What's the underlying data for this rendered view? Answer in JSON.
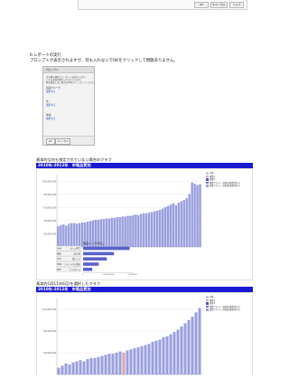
{
  "top_dialog": {
    "buttons": [
      "OK",
      "キャンセル",
      "ヘルプ"
    ]
  },
  "step": {
    "lines": [
      "6.レポートの実行",
      "プロンプトが表示されますが、何も入れないでOKをクリックして問題ありません。"
    ]
  },
  "prompt_dialog": {
    "title": "プロンプト",
    "help_lines": [
      "次の値を選択してレポートを表示します。",
      "これらは既定値が入力されています。",
      "値を変更しない場合はOKをクリックしてください。"
    ],
    "fields": [
      {
        "label": "商品グループ:",
        "value": "選択する"
      },
      {
        "label": "年:",
        "value": "選択する"
      },
      {
        "label": "地域:",
        "value": "選択する"
      }
    ],
    "buttons": {
      "ok": "OK",
      "cancel": "キャンセル"
    }
  },
  "section1": {
    "title": "基本的な何も指定されていない場合のグラフ",
    "banner": "2010年-2012年　市場品質別",
    "legend": [
      {
        "name": "全体",
        "color": "#c9c9ea"
      },
      {
        "name": "施策1",
        "color": "#e8a2a2"
      },
      {
        "name": "施策3",
        "color": "#4b54c2"
      },
      {
        "name": "施策アクティ 実施品(施策3区分)",
        "color": "#6f77d0"
      },
      {
        "name": "施策アクティ 実施品(施策4区分)",
        "color": "#9aa0dd"
      }
    ]
  },
  "top10": {
    "title": "製品トップ10売上",
    "rows": [
      {
        "label": "AAA",
        "value": "ボトル/PET",
        "frac": 0.92
      },
      {
        "label": "BBB",
        "value": "缶/LAN",
        "frac": 0.61
      },
      {
        "label": "CCC",
        "value": "紙パック",
        "frac": 0.47
      },
      {
        "label": "DDD",
        "value": "コーヒー/その他缶",
        "frac": 0.31
      },
      {
        "label": "EEE",
        "value": "ビン/ボトル",
        "frac": 0.18
      }
    ],
    "axis": [
      "0",
      "1,000,000,000",
      "2,000,000,000"
    ]
  },
  "section2": {
    "title": "基本的(2011年6月)を選択したグラフ",
    "banner": "2010年-2012年　市場品質別"
  },
  "chart_data": [
    {
      "type": "bar",
      "title": "",
      "xlabel": "",
      "ylabel": "",
      "y_tick_labels": [
        "100,000,000",
        "80,000,000",
        "60,000,000",
        "40,000,000",
        "20,000,000"
      ],
      "ylim": [
        0,
        110000000
      ],
      "legend": "right",
      "values": [
        31000000,
        33000000,
        34000000,
        32000000,
        35000000,
        36000000,
        36000000,
        35000000,
        36000000,
        37000000,
        37000000,
        38000000,
        39000000,
        40000000,
        41000000,
        41000000,
        42000000,
        42000000,
        43000000,
        43000000,
        44000000,
        44000000,
        45000000,
        45000000,
        46000000,
        46000000,
        47000000,
        47000000,
        48000000,
        49000000,
        48000000,
        50000000,
        51000000,
        51000000,
        52000000,
        53000000,
        54000000,
        55000000,
        56000000,
        58000000,
        60000000,
        62000000,
        64000000,
        66000000,
        63000000,
        67000000,
        69000000,
        71000000,
        74000000,
        80000000,
        98000000,
        96000000,
        94000000,
        95000000
      ]
    },
    {
      "type": "bar",
      "title": "",
      "xlabel": "",
      "ylabel": "",
      "y_tick_labels": [
        "100,000,000",
        "80,000,000",
        "60,000,000"
      ],
      "ylim": [
        40000000,
        110000000
      ],
      "legend": "right",
      "highlight_index": 18,
      "values": [
        46000000,
        48000000,
        50000000,
        49000000,
        51000000,
        52000000,
        53000000,
        52000000,
        54000000,
        55000000,
        55000000,
        56000000,
        57000000,
        58000000,
        59000000,
        59000000,
        60000000,
        61000000,
        60000000,
        62000000,
        63000000,
        64000000,
        65000000,
        66000000,
        67000000,
        68000000,
        70000000,
        71000000,
        72000000,
        74000000,
        75000000,
        77000000,
        79000000,
        81000000,
        84000000,
        87000000,
        90000000,
        93000000,
        97000000,
        101000000
      ]
    }
  ]
}
